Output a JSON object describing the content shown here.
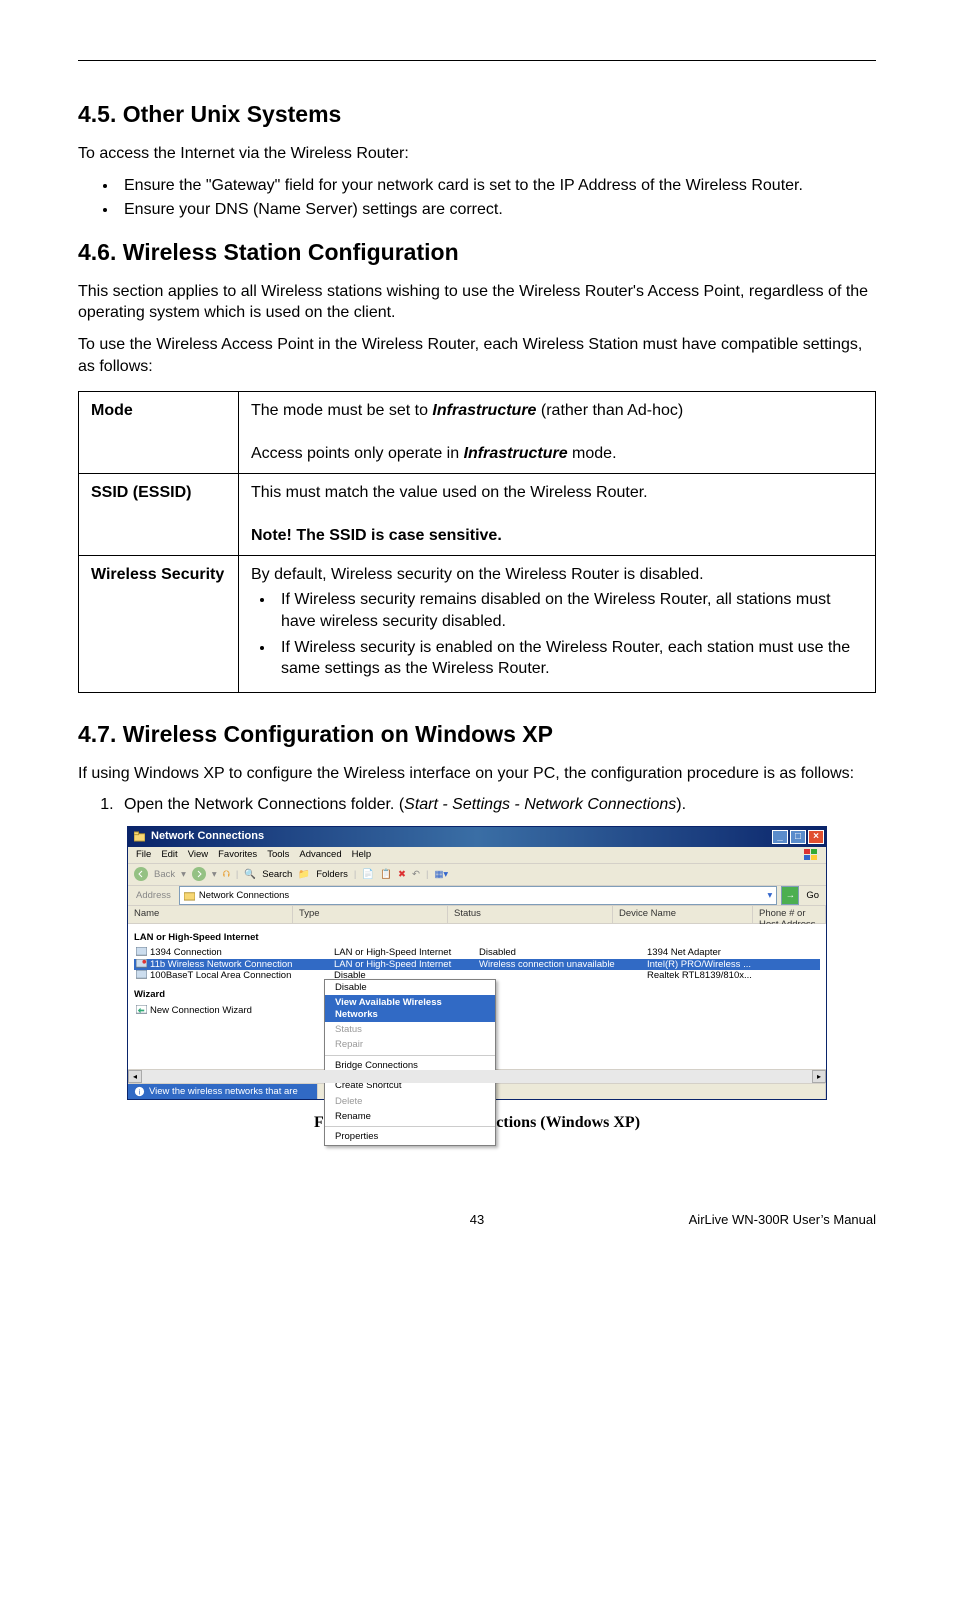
{
  "section_45": {
    "heading": "4.5. Other Unix Systems",
    "intro": "To access the Internet via the Wireless Router:",
    "bullets": [
      "Ensure the \"Gateway\" field for your network card is set to the IP Address of the Wireless Router.",
      "Ensure your DNS (Name Server) settings are correct."
    ]
  },
  "section_46": {
    "heading": "4.6. Wireless Station Configuration",
    "p1": "This section applies to all Wireless stations wishing to use the Wireless Router's Access Point, regardless of the operating system which is used on the client.",
    "p2": "To use the Wireless Access Point in the Wireless Router, each Wireless Station must have compatible settings, as follows:",
    "table": {
      "rows": [
        {
          "label": "Mode",
          "html": "The mode must be set to <span class='strong-i'>Infrastructure</span> (rather than Ad-hoc)<br><br>Access points only operate in <span class='strong-i'>Infrastructure</span> mode."
        },
        {
          "label": "SSID (ESSID)",
          "html": "This must match the value used on the Wireless Router.<br><br><b>Note! The SSID is case sensitive.</b>"
        },
        {
          "label": "Wireless Security",
          "html": "By default, Wireless security on the Wireless Router is disabled.<ul class='inner-bullets'><li>If Wireless security remains disabled on the Wireless Router, all stations must have wireless security disabled.</li><li>If Wireless security is enabled on the Wireless Router, each station must use the same settings as the Wireless Router.</li></ul>"
        }
      ]
    }
  },
  "section_47": {
    "heading": "4.7. Wireless Configuration on Windows XP",
    "intro": "If using Windows XP to configure the Wireless interface on your PC, the configuration procedure is as follows:",
    "step1_pre": "Open the Network Connections folder. (",
    "step1_em": "Start - Settings - Network Connections",
    "step1_post": ")."
  },
  "screenshot": {
    "title": "Network Connections",
    "menu": [
      "File",
      "Edit",
      "View",
      "Favorites",
      "Tools",
      "Advanced",
      "Help"
    ],
    "toolbar": {
      "back": "Back",
      "search": "Search",
      "folders": "Folders"
    },
    "address_label": "Address",
    "address_value": "Network Connections",
    "go_label": "Go",
    "columns": [
      "Name",
      "Type",
      "Status",
      "Device Name",
      "Phone # or Host Address"
    ],
    "group1": "LAN or High-Speed Internet",
    "rows": [
      {
        "name": "1394 Connection",
        "type": "LAN or High-Speed Internet",
        "status": "Disabled",
        "device": "1394 Net Adapter"
      },
      {
        "name": "11b Wireless Network Connection",
        "type": "LAN or High-Speed Internet",
        "status": "Wireless connection unavailable",
        "device": "Intel(R) PRO/Wireless ..."
      },
      {
        "name": "100BaseT Local Area Connection",
        "type": "Disable",
        "status": "",
        "device": "Realtek RTL8139/810x..."
      }
    ],
    "group2": "Wizard",
    "wizard_item": "New Connection Wizard",
    "context_menu": [
      {
        "label": "Disable",
        "state": "normal"
      },
      {
        "label": "View Available Wireless Networks",
        "state": "highlight"
      },
      {
        "label": "Status",
        "state": "disabled"
      },
      {
        "label": "Repair",
        "state": "disabled"
      },
      {
        "sep": true
      },
      {
        "label": "Bridge Connections",
        "state": "normal"
      },
      {
        "sep": true
      },
      {
        "label": "Create Shortcut",
        "state": "normal"
      },
      {
        "label": "Delete",
        "state": "disabled"
      },
      {
        "label": "Rename",
        "state": "normal"
      },
      {
        "sep": true
      },
      {
        "label": "Properties",
        "state": "normal"
      }
    ],
    "status_text": "View the wireless networks that are"
  },
  "figure_caption": "Figure 26: Network Connections (Windows XP)",
  "footer": {
    "page": "43",
    "manual": "AirLive WN-300R User’s Manual"
  }
}
